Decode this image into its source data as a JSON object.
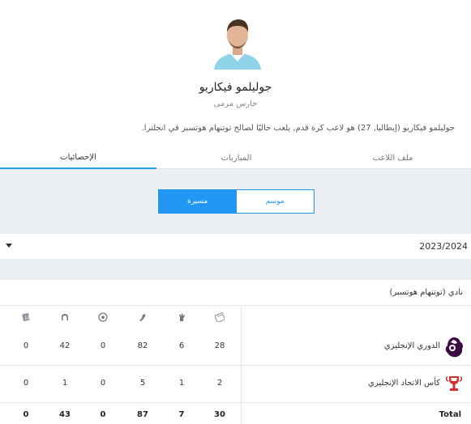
{
  "player": {
    "name": "جوليلمو فيكاريو",
    "position": "حارس مرمى",
    "bio": "جوليلمو فيكاريو (إيطاليا, 27) هو لاعب كرة قدم, يلعب حاليًا لصالح توتنهام هوتسبر في انجلترا."
  },
  "tabs": [
    {
      "label": "ملف اللاعب",
      "active": false
    },
    {
      "label": "المباريات",
      "active": false
    },
    {
      "label": "الإحصائيات",
      "active": true
    }
  ],
  "switch": {
    "season_label": "موسم",
    "career_label": "مسيرة",
    "selected": "career"
  },
  "season": {
    "value": "2023/2024"
  },
  "club": {
    "label": "نادي (توتنهام هوتسبر)"
  },
  "stat_icons": [
    "calendar-icon",
    "goalkeeper-glove-icon",
    "boot-icon",
    "football-icon",
    "save-icon",
    "shirt-icon"
  ],
  "competitions": [
    {
      "name": "الدوري الإنجليزي",
      "logo": "premier-league-logo",
      "values": [
        "28",
        "6",
        "82",
        "0",
        "42",
        "0"
      ]
    },
    {
      "name": "كأس الاتحاد الإنجليزي",
      "logo": "fa-cup-logo",
      "values": [
        "2",
        "1",
        "5",
        "0",
        "1",
        "0"
      ]
    }
  ],
  "totals": {
    "label": "Total",
    "values": [
      "30",
      "7",
      "87",
      "0",
      "43",
      "0"
    ]
  },
  "colors": {
    "accent": "#2196f3",
    "band": "#eceff1"
  }
}
